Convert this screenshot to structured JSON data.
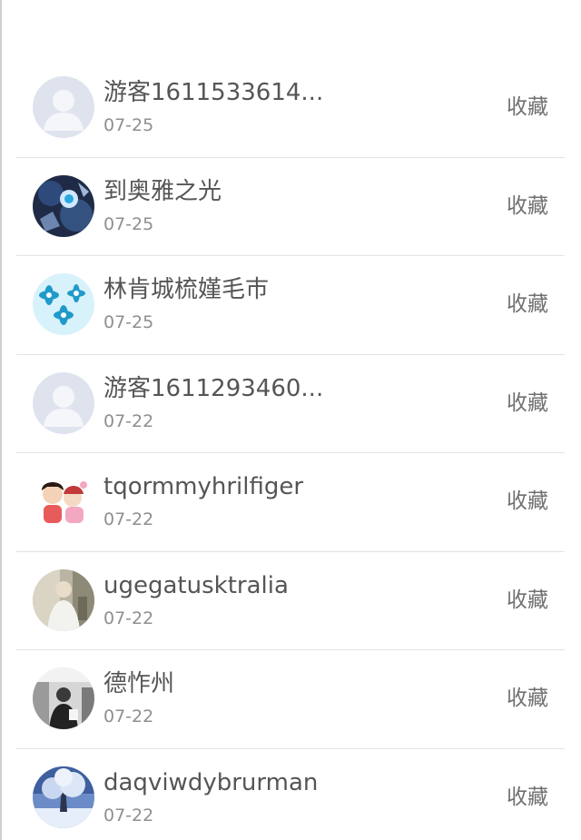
{
  "favorites": {
    "items": [
      {
        "name": "游客1611533614...",
        "date": "07-25",
        "action": "收藏",
        "avatar": "default-user-avatar"
      },
      {
        "name": "到奥雅之光",
        "date": "07-25",
        "action": "收藏",
        "avatar": "robot-avatar"
      },
      {
        "name": "林肯城梳嫤毛巿",
        "date": "07-25",
        "action": "收藏",
        "avatar": "flower-avatar"
      },
      {
        "name": "游客1611293460...",
        "date": "07-22",
        "action": "收藏",
        "avatar": "default-user-avatar"
      },
      {
        "name": "tqormmyhrilfiger",
        "date": "07-22",
        "action": "收藏",
        "avatar": "cartoon-couple-avatar"
      },
      {
        "name": "ugegatusktralia",
        "date": "07-22",
        "action": "收藏",
        "avatar": "photo-person-avatar"
      },
      {
        "name": "德怍州",
        "date": "07-22",
        "action": "收藏",
        "avatar": "bw-photo-avatar"
      },
      {
        "name": "daqviwdybrurman",
        "date": "07-22",
        "action": "收藏",
        "avatar": "winter-tree-avatar"
      }
    ]
  }
}
